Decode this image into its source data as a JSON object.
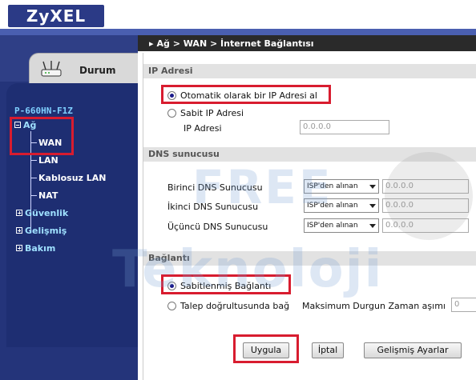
{
  "brand": {
    "logo_text": "ZyXEL"
  },
  "sidebar": {
    "status_tab_label": "Durum",
    "device_model": "P-660HN-F1Z",
    "items": [
      {
        "label": "Ağ"
      },
      {
        "label": "WAN"
      },
      {
        "label": "LAN"
      },
      {
        "label": "Kablosuz LAN"
      },
      {
        "label": "NAT"
      },
      {
        "label": "Güvenlik"
      },
      {
        "label": "Gelişmiş"
      },
      {
        "label": "Bakım"
      }
    ]
  },
  "main": {
    "breadcrumb": "Ağ > WAN > İnternet Bağlantısı",
    "ip_section": {
      "title": "IP Adresi",
      "option_auto": "Otomatik olarak bir IP Adresi al",
      "option_static": "Sabit IP Adresi",
      "ip_label": "IP Adresi",
      "ip_value": "0.0.0.0"
    },
    "dns_section": {
      "title": "DNS sunucusu",
      "rows": [
        {
          "label": "Birinci DNS Sunucusu",
          "select": "ISP'den alınan",
          "value": "0.0.0.0"
        },
        {
          "label": "İkinci DNS Sunucusu",
          "select": "ISP'den alınan",
          "value": "0.0.0.0"
        },
        {
          "label": "Üçüncü DNS Sunucusu",
          "select": "ISP'den alınan",
          "value": "0.0.0.0"
        }
      ]
    },
    "connection_section": {
      "title": "Bağlantı",
      "option_always": "Sabitlenmiş Bağlantı",
      "option_on_demand": "Talep doğrultusunda bağ",
      "idle_label": "Maksimum Durgun Zaman aşımı",
      "idle_value": "0"
    },
    "buttons": {
      "apply": "Uygula",
      "cancel": "İptal",
      "advanced": "Gelişmiş Ayarlar"
    }
  },
  "watermark": {
    "line1": "FREE",
    "line2": "Teknoloji"
  },
  "colors": {
    "highlight": "#d81c2f",
    "sidebar": "#24347a",
    "header_band": "#4a5fb0"
  }
}
